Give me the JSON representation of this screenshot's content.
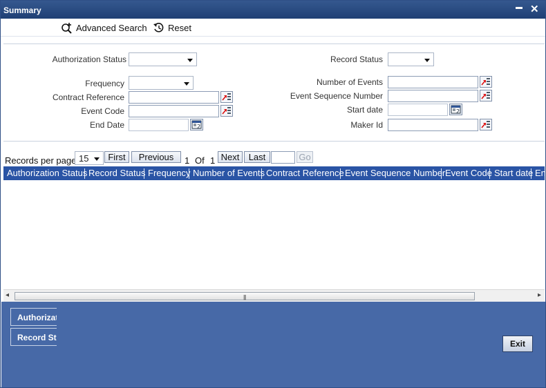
{
  "window": {
    "title": "Summary",
    "minimize_glyph": "▬",
    "close_glyph": "✕"
  },
  "toolbar": {
    "advanced_search": "Advanced Search",
    "reset": "Reset"
  },
  "form": {
    "authorization_status": {
      "label": "Authorization Status",
      "value": ""
    },
    "record_status": {
      "label": "Record Status",
      "value": ""
    },
    "frequency": {
      "label": "Frequency",
      "value": ""
    },
    "number_of_events": {
      "label": "Number of Events",
      "value": ""
    },
    "contract_reference": {
      "label": "Contract Reference",
      "value": ""
    },
    "event_sequence_number": {
      "label": "Event Sequence Number",
      "value": ""
    },
    "event_code": {
      "label": "Event Code",
      "value": ""
    },
    "start_date": {
      "label": "Start date",
      "value": ""
    },
    "end_date": {
      "label": "End Date",
      "value": ""
    },
    "maker_id": {
      "label": "Maker Id",
      "value": ""
    }
  },
  "pager": {
    "records_per_page_label": "Records per page",
    "records_per_page": "15",
    "first": "First",
    "previous": "Previous",
    "current_page": "1",
    "of": "Of",
    "total_pages": "1",
    "next": "Next",
    "last": "Last",
    "goto_value": "",
    "go": "Go"
  },
  "grid": {
    "columns": [
      "Authorization Status",
      "Record Status",
      "Frequency",
      "Number of Events",
      "Contract Reference",
      "Event Sequence Number",
      "Event Code",
      "Start date",
      "End Date"
    ]
  },
  "scrollbar": {
    "left_arrow": "◂",
    "right_arrow": "▸",
    "grip": "|||"
  },
  "footer": {
    "btn_authorization": "Authorization Status",
    "btn_record": "Record Status",
    "exit": "Exit"
  },
  "colors": {
    "titlebar": "#1f3f74",
    "grid_header": "#2a54a5",
    "footer": "#4769a7"
  },
  "icons": {
    "advanced_search": "search-plus-icon",
    "reset": "reset-icon",
    "lov": "list-of-values-icon",
    "calendar": "calendar-icon"
  }
}
